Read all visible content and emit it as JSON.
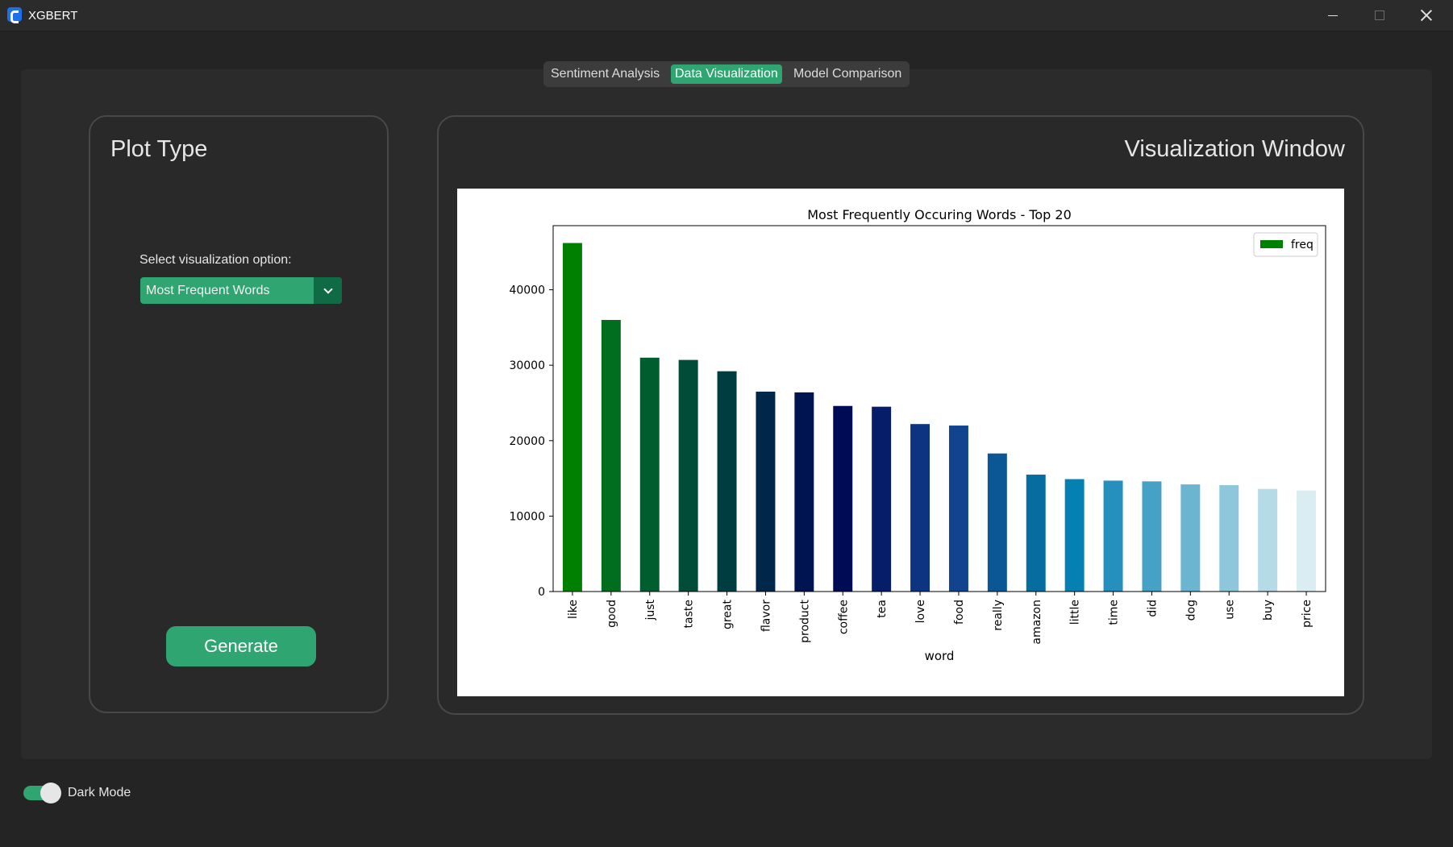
{
  "window": {
    "title": "XGBERT",
    "minimize_icon": "minimize-icon",
    "maximize_icon": "maximize-icon",
    "close_icon": "close-icon"
  },
  "tabs": [
    {
      "label": "Sentiment Analysis",
      "active": false
    },
    {
      "label": "Data Visualization",
      "active": true
    },
    {
      "label": "Model Comparison",
      "active": false
    }
  ],
  "left_panel": {
    "title": "Plot Type",
    "select_label": "Select visualization option:",
    "dropdown_value": "Most Frequent Words",
    "generate_label": "Generate"
  },
  "right_panel": {
    "title": "Visualization Window"
  },
  "footer": {
    "dark_mode_label": "Dark Mode",
    "dark_mode_on": true
  },
  "colors": {
    "accent": "#2fa572",
    "accent_dark": "#106a43",
    "background": "#242424",
    "panel": "#2b2b2b"
  },
  "chart_data": {
    "type": "bar",
    "title": "Most Frequently Occuring Words - Top 20",
    "xlabel": "word",
    "ylabel": "",
    "legend": [
      "freq"
    ],
    "legend_position": "top-right",
    "ylim": [
      0,
      48500
    ],
    "yticks": [
      0,
      10000,
      20000,
      30000,
      40000
    ],
    "categories": [
      "like",
      "good",
      "just",
      "taste",
      "great",
      "flavor",
      "product",
      "coffee",
      "tea",
      "love",
      "food",
      "really",
      "amazon",
      "little",
      "time",
      "did",
      "dog",
      "use",
      "buy",
      "price"
    ],
    "series": [
      {
        "name": "freq",
        "values": [
          46200,
          36000,
          31000,
          30700,
          29200,
          26500,
          26400,
          24600,
          24500,
          22200,
          22000,
          18300,
          15500,
          14900,
          14700,
          14600,
          14200,
          14100,
          13600,
          13400
        ]
      }
    ],
    "bar_colors": [
      "#008000",
      "#006d1f",
      "#005d2e",
      "#004c38",
      "#003d40",
      "#00264a",
      "#001452",
      "#000b56",
      "#061d6a",
      "#0d3480",
      "#11438f",
      "#0b5795",
      "#056d9f",
      "#0580b2",
      "#2590be",
      "#45a1c6",
      "#6bb5d1",
      "#8ec7dc",
      "#b4dbe6",
      "#d9edf3"
    ],
    "grid": false
  }
}
